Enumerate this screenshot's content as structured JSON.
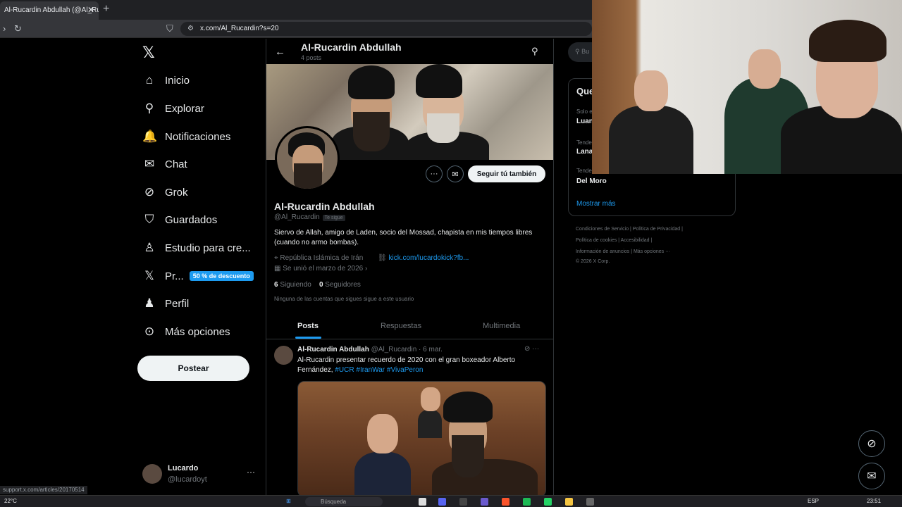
{
  "browser": {
    "tab_title": "Al-Rucardin Abdullah (@Al_Ruca",
    "tab_close": "✕",
    "new_tab": "+",
    "url": "x.com/Al_Rucardin?s=20",
    "status_url": "support.x.com/articles/20170514"
  },
  "sidebar": {
    "logo": "𝕏",
    "items": [
      {
        "label": "Inicio",
        "icon": "home-icon",
        "glyph": "⌂"
      },
      {
        "label": "Explorar",
        "icon": "search-icon",
        "glyph": "⚲"
      },
      {
        "label": "Notificaciones",
        "icon": "bell-icon",
        "glyph": "🔔"
      },
      {
        "label": "Chat",
        "icon": "mail-icon",
        "glyph": "✉"
      },
      {
        "label": "Grok",
        "icon": "grok-icon",
        "glyph": "⊘"
      },
      {
        "label": "Guardados",
        "icon": "bookmark-icon",
        "glyph": "⛉"
      },
      {
        "label": "Estudio para cre...",
        "icon": "studio-icon",
        "glyph": "♙"
      },
      {
        "label": "Pr...",
        "icon": "x-premium-icon",
        "glyph": "𝕏"
      },
      {
        "label": "Perfil",
        "icon": "profile-icon",
        "glyph": "♟"
      },
      {
        "label": "Más opciones",
        "icon": "more-icon",
        "glyph": "⊙"
      }
    ],
    "promo_badge": "50 % de descuento",
    "post_button": "Postear",
    "account": {
      "name": "Lucardo",
      "handle": "@lucardoyt",
      "more": "···"
    }
  },
  "profile": {
    "header_name": "Al-Rucardin Abdullah",
    "header_posts": "4 posts",
    "name": "Al-Rucardin Abdullah",
    "handle": "@Al_Rucardin",
    "follows_you": "Te sigue",
    "bio": "Siervo de Allah, amigo de Laden, socio del Mossad, chapista en mis tiempos libres (cuando no armo bombas).",
    "location": "República Islámica de Irán",
    "link": "kick.com/lucardokick?fb...",
    "joined": "Se unió el marzo de 2026",
    "following_count": "6",
    "following_label": "Siguiendo",
    "followers_count": "0",
    "followers_label": "Seguidores",
    "no_followers_note": "Ninguna de las cuentas que sigues sigue a este usuario",
    "follow_button": "Seguir tú también",
    "more_button": "···",
    "message_button": "✉",
    "tabs": [
      "Posts",
      "Respuestas",
      "Multimedia"
    ]
  },
  "post": {
    "author": "Al-Rucardin Abdullah",
    "handle": "@Al_Rucardin",
    "date": "· 6 mar.",
    "text": "Al-Rucardin presentar recuerdo de 2020 con el gran boxeador Alberto Fernández, ",
    "hashtags": "#UCR #IranWar #VivaPeron",
    "tools": "⊘  ···"
  },
  "right": {
    "search_placeholder": "Bu",
    "trends_title": "Que",
    "trends": [
      {
        "context": "Solo e",
        "name": "Luan"
      },
      {
        "context": "Tende",
        "name": "Lana"
      },
      {
        "context": "Tende",
        "name": "Del Moro"
      }
    ],
    "show_more": "Mostrar más",
    "footer": [
      "Condiciones de Servicio  |  Política de Privacidad  |",
      "Política de cookies  |  Accesibilidad  |",
      "Información de anuncios  |  Más opciones ···",
      "© 2026 X Corp."
    ]
  },
  "taskbar": {
    "weather": "22°C",
    "search": "Búsqueda",
    "lang": "ESP",
    "time": "23:51"
  }
}
